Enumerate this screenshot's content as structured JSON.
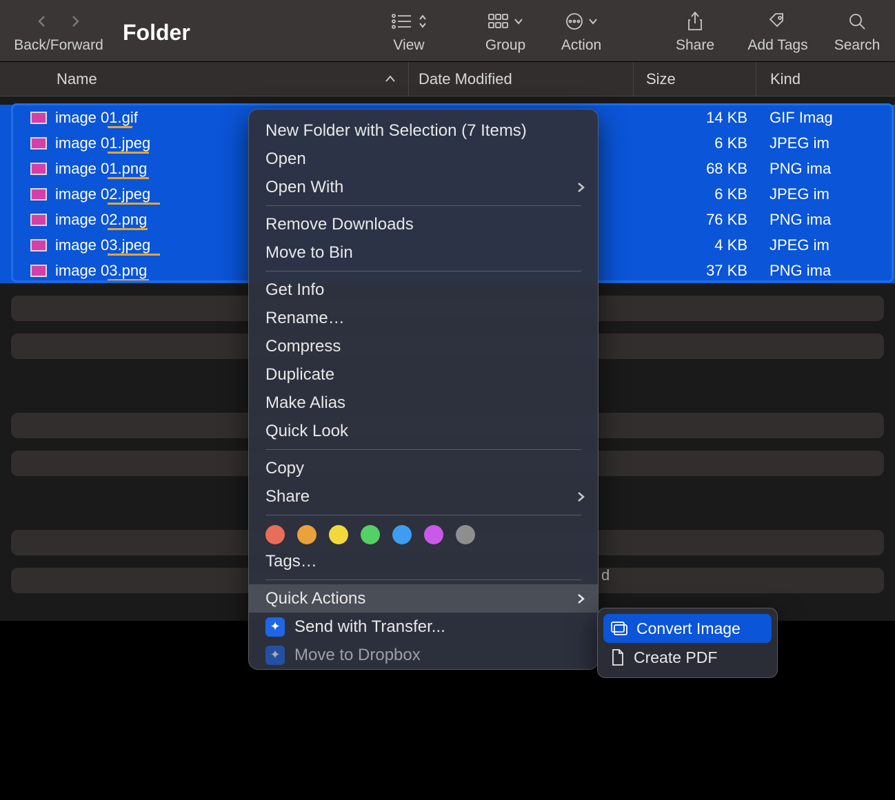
{
  "window_title": "Folder",
  "toolbar": {
    "back_forward": "Back/Forward",
    "view": "View",
    "group": "Group",
    "action": "Action",
    "share": "Share",
    "add_tags": "Add Tags",
    "search": "Search"
  },
  "columns": {
    "name": "Name",
    "date_modified": "Date Modified",
    "size": "Size",
    "kind": "Kind"
  },
  "files": [
    {
      "name": "image 01.gif",
      "size": "14 KB",
      "kind": "GIF Imag"
    },
    {
      "name": "image 01.jpeg",
      "size": "6 KB",
      "kind": "JPEG im"
    },
    {
      "name": "image 01.png",
      "size": "68 KB",
      "kind": "PNG ima"
    },
    {
      "name": "image 02.jpeg",
      "size": "6 KB",
      "kind": "JPEG im"
    },
    {
      "name": "image 02.png",
      "size": "76 KB",
      "kind": "PNG ima"
    },
    {
      "name": "image 03.jpeg",
      "size": "4 KB",
      "kind": "JPEG im"
    },
    {
      "name": "image 03.png",
      "size": "37 KB",
      "kind": "PNG ima"
    }
  ],
  "context_menu": {
    "new_folder": "New Folder with Selection (7 Items)",
    "open": "Open",
    "open_with": "Open With",
    "remove_downloads": "Remove Downloads",
    "move_to_bin": "Move to Bin",
    "get_info": "Get Info",
    "rename": "Rename…",
    "compress": "Compress",
    "duplicate": "Duplicate",
    "make_alias": "Make Alias",
    "quick_look": "Quick Look",
    "copy": "Copy",
    "share": "Share",
    "tags": "Tags…",
    "quick_actions": "Quick Actions",
    "send_with_transfer": "Send with Transfer...",
    "move_to_dropbox": "Move to Dropbox"
  },
  "tag_colors": [
    "#e96d58",
    "#eaa23a",
    "#f2d83c",
    "#55d065",
    "#3c9df2",
    "#c95ae8",
    "#8e8e8e"
  ],
  "sub_menu": {
    "convert_image": "Convert Image",
    "create_pdf": "Create PDF"
  },
  "leak_text": "d"
}
